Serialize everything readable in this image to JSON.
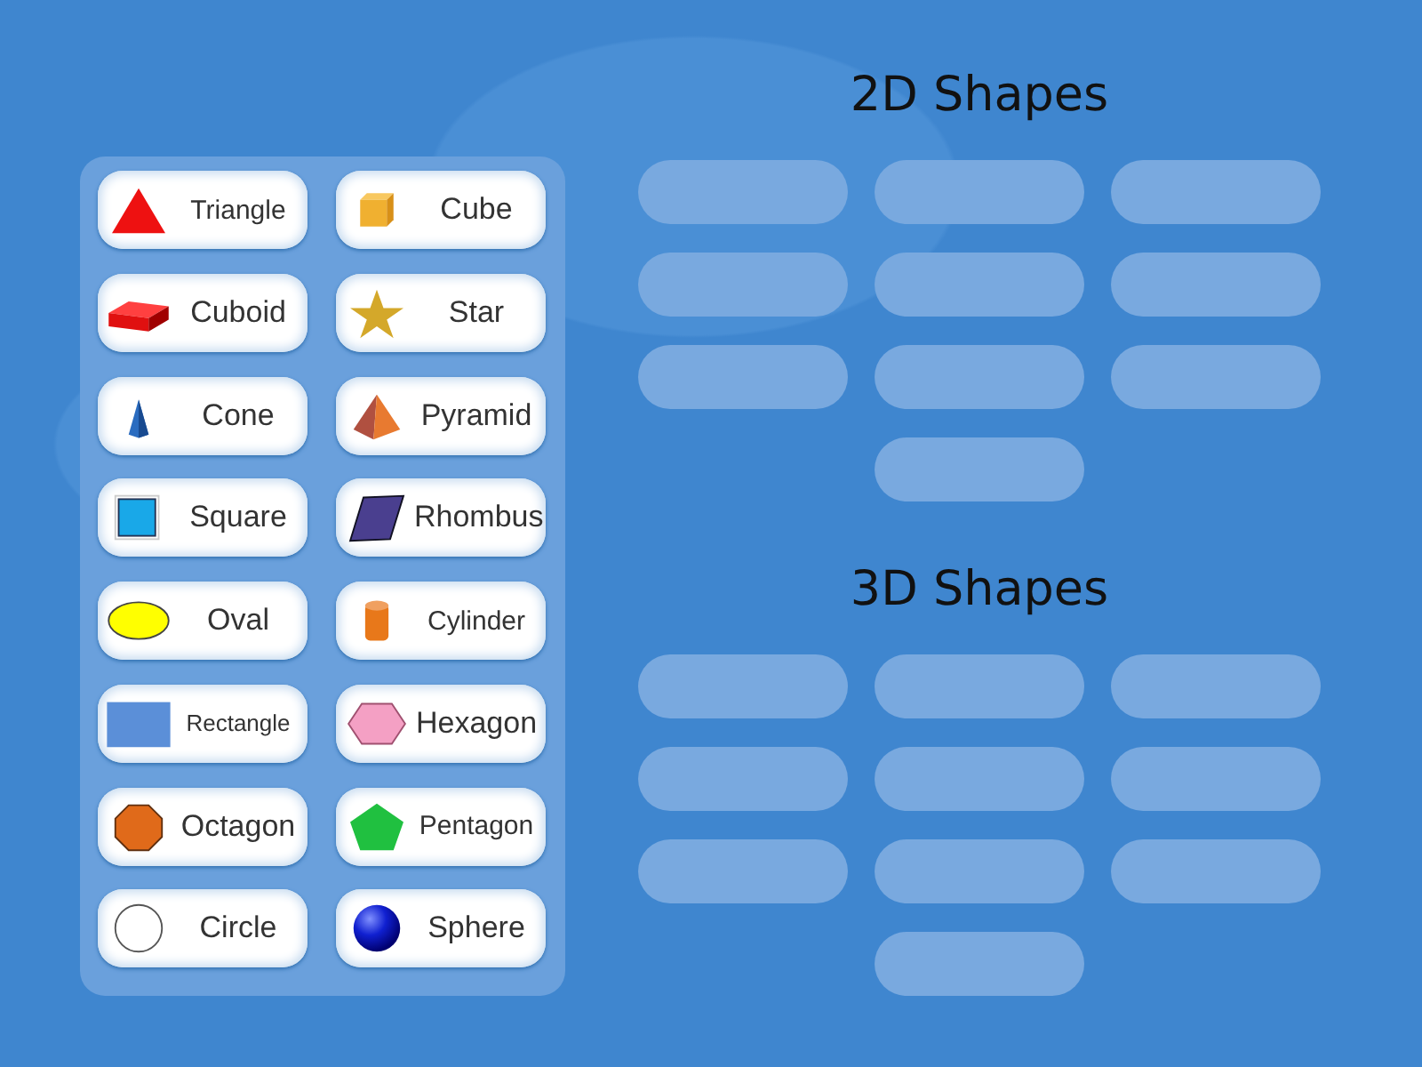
{
  "cards": [
    {
      "label": "Triangle",
      "kind": "triangle"
    },
    {
      "label": "Cube",
      "kind": "cube"
    },
    {
      "label": "Cuboid",
      "kind": "cuboid"
    },
    {
      "label": "Star",
      "kind": "star"
    },
    {
      "label": "Cone",
      "kind": "cone"
    },
    {
      "label": "Pyramid",
      "kind": "pyramid"
    },
    {
      "label": "Square",
      "kind": "square"
    },
    {
      "label": "Rhombus",
      "kind": "rhombus"
    },
    {
      "label": "Oval",
      "kind": "oval"
    },
    {
      "label": "Cylinder",
      "kind": "cylinder"
    },
    {
      "label": "Rectangle",
      "kind": "rectangle"
    },
    {
      "label": "Hexagon",
      "kind": "hexagon"
    },
    {
      "label": "Octagon",
      "kind": "octagon"
    },
    {
      "label": "Pentagon",
      "kind": "pentagon"
    },
    {
      "label": "Circle",
      "kind": "circle"
    },
    {
      "label": "Sphere",
      "kind": "sphere"
    }
  ],
  "groups": [
    {
      "title": "2D Shapes",
      "slots": [
        {
          "filled": false
        },
        {
          "filled": false
        },
        {
          "filled": false
        },
        {
          "filled": false
        },
        {
          "filled": false
        },
        {
          "filled": false
        },
        {
          "filled": false
        },
        {
          "filled": false
        },
        {
          "filled": false
        },
        {
          "filled": false
        }
      ]
    },
    {
      "title": "3D Shapes",
      "slots": [
        {
          "filled": false
        },
        {
          "filled": false
        },
        {
          "filled": false
        },
        {
          "filled": false
        },
        {
          "filled": false
        },
        {
          "filled": false
        },
        {
          "filled": false
        },
        {
          "filled": false
        },
        {
          "filled": false
        },
        {
          "filled": false
        }
      ]
    }
  ]
}
